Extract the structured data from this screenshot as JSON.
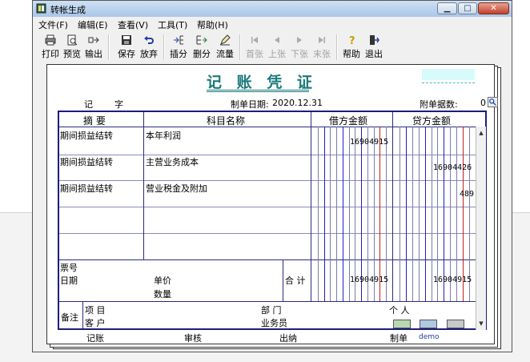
{
  "window": {
    "title": "转帐生成"
  },
  "window_buttons": {
    "minimize": "▁",
    "maximize": "□",
    "close": "✕"
  },
  "menu": [
    "文件(F)",
    "编辑(E)",
    "查看(V)",
    "工具(T)",
    "帮助(H)"
  ],
  "toolbar": [
    {
      "label": "打印",
      "icon": "printer-icon",
      "enabled": true
    },
    {
      "label": "预览",
      "icon": "preview-icon",
      "enabled": true
    },
    {
      "label": "输出",
      "icon": "export-icon",
      "enabled": true
    },
    {
      "label": "保存",
      "icon": "save-icon",
      "enabled": true
    },
    {
      "label": "放弃",
      "icon": "undo-icon",
      "enabled": true
    },
    {
      "label": "插分",
      "icon": "insert-row-icon",
      "enabled": true
    },
    {
      "label": "删分",
      "icon": "delete-row-icon",
      "enabled": true
    },
    {
      "label": "流量",
      "icon": "pencil-icon",
      "enabled": true
    },
    {
      "label": "首张",
      "icon": "first-icon",
      "enabled": false
    },
    {
      "label": "上张",
      "icon": "prev-icon",
      "enabled": false
    },
    {
      "label": "下张",
      "icon": "next-icon",
      "enabled": false
    },
    {
      "label": "末张",
      "icon": "last-icon",
      "enabled": false
    },
    {
      "label": "帮助",
      "icon": "help-icon",
      "enabled": true
    },
    {
      "label": "退出",
      "icon": "exit-icon",
      "enabled": true
    }
  ],
  "voucher": {
    "title": "记 账 凭 证",
    "type_label": "记",
    "type_suffix": "字",
    "date_label": "制单日期:",
    "date": "2020.12.31",
    "attach_label": "附单据数:",
    "attach_count": "0",
    "headers": {
      "summary": "摘 要",
      "account": "科目名称",
      "debit": "借方金额",
      "credit": "贷方金额"
    },
    "rows": [
      {
        "summary": "期间损益结转",
        "account": "本年利润",
        "debit": "16904915",
        "credit": ""
      },
      {
        "summary": "期间损益结转",
        "account": "主营业务成本",
        "debit": "",
        "credit": "16904426"
      },
      {
        "summary": "期间损益结转",
        "account": "营业税金及附加",
        "debit": "",
        "credit": "489"
      },
      {
        "summary": "",
        "account": "",
        "debit": "",
        "credit": ""
      },
      {
        "summary": "",
        "account": "",
        "debit": "",
        "credit": ""
      }
    ],
    "totals": {
      "ticket_label": "票号",
      "date_label": "日期",
      "price_label": "单价",
      "qty_label": "数量",
      "total_label": "合 计",
      "debit": "16904915",
      "credit": "16904915"
    },
    "remarks": {
      "label": "备注",
      "project_label": "项  目",
      "customer_label": "客  户",
      "dept_label": "部  门",
      "person_label": "个  人",
      "salesman_label": "业务员"
    },
    "footer": {
      "bookkeeper_label": "记账",
      "reviewer_label": "审核",
      "cashier_label": "出纳",
      "preparer_label": "制单",
      "preparer": "demo"
    }
  },
  "colors": {
    "title": "#1a7a7a",
    "grid": "#1d1d7a",
    "debit_line_red": "#c02020",
    "debit_line_blue": "#2020c0"
  }
}
